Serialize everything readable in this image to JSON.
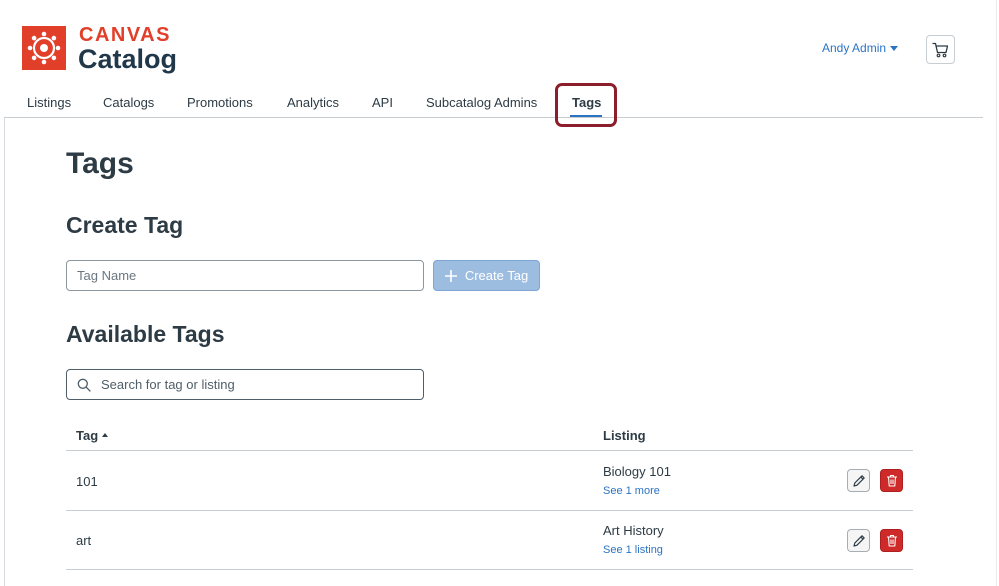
{
  "brand": {
    "line1": "CANVAS",
    "line2": "Catalog",
    "color": "#e13f29"
  },
  "header": {
    "user_name": "Andy Admin",
    "cart_icon": "cart-icon"
  },
  "nav": {
    "tabs": [
      {
        "label": "Listings"
      },
      {
        "label": "Catalogs"
      },
      {
        "label": "Promotions"
      },
      {
        "label": "Analytics"
      },
      {
        "label": "API"
      },
      {
        "label": "Subcatalog Admins"
      },
      {
        "label": "Tags",
        "active": true
      }
    ]
  },
  "page": {
    "title": "Tags",
    "create_heading": "Create Tag",
    "tag_name_placeholder": "Tag Name",
    "create_button_label": "Create Tag",
    "available_heading": "Available Tags",
    "search_placeholder": "Search for tag or listing"
  },
  "table": {
    "columns": {
      "tag": "Tag",
      "listing": "Listing"
    },
    "rows": [
      {
        "tag": "101",
        "listing": "Biology 101",
        "link": "See 1 more"
      },
      {
        "tag": "art",
        "listing": "Art History",
        "link": "See 1 listing"
      }
    ]
  },
  "colors": {
    "accent": "#2b74c4",
    "danger": "#cf2a2a",
    "highlight": "#8c1d2a"
  }
}
